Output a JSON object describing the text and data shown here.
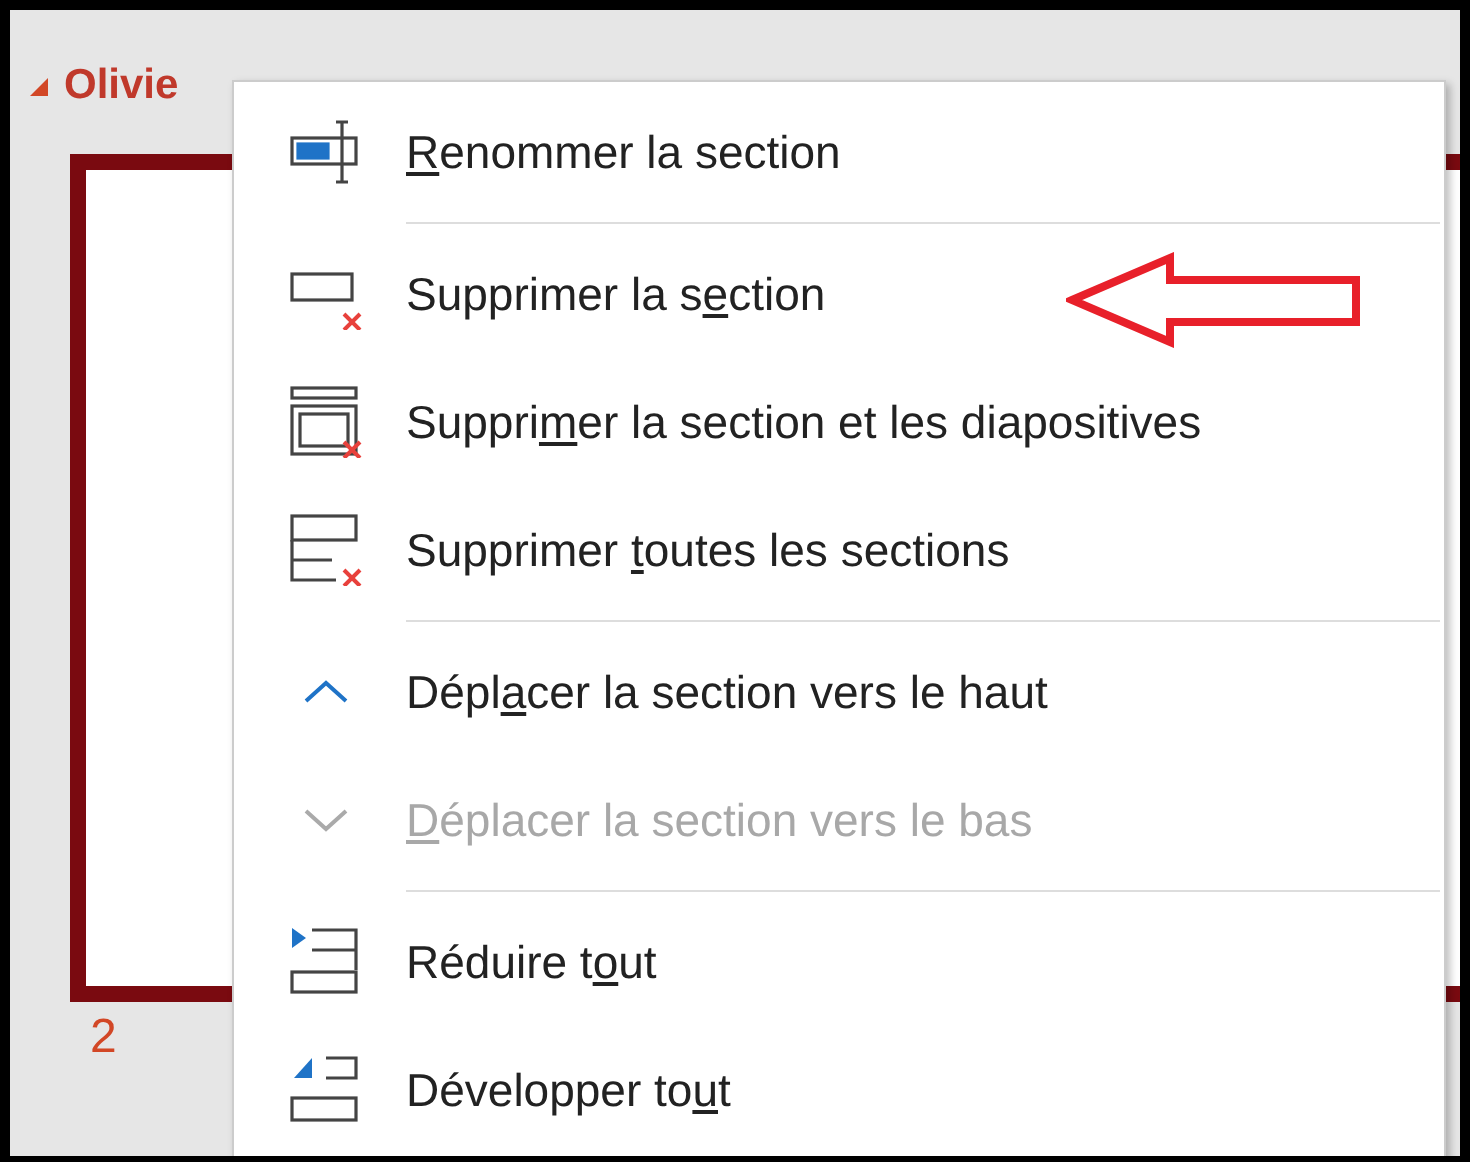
{
  "section_header": {
    "title": "Olivie",
    "expanded": true
  },
  "slide_number": "2",
  "context_menu": {
    "groups": [
      [
        {
          "disabled": false,
          "label": {
            "key": "R",
            "after": "enommer la section"
          }
        }
      ],
      [
        {
          "disabled": false,
          "label": {
            "before": "Supprimer la s",
            "key": "e",
            "after": "ction"
          }
        },
        {
          "disabled": false,
          "label": {
            "before": "Suppri",
            "key": "m",
            "after": "er la section et les diapositives"
          }
        },
        {
          "disabled": false,
          "label": {
            "before": "Supprimer ",
            "key": "t",
            "after": "outes les sections"
          }
        }
      ],
      [
        {
          "disabled": false,
          "label": {
            "before": "Dépl",
            "key": "a",
            "after": "cer la section vers le haut"
          }
        },
        {
          "disabled": true,
          "label": {
            "key": "D",
            "after": "éplacer la section vers le bas"
          }
        }
      ],
      [
        {
          "disabled": false,
          "label": {
            "before": "Réduire t",
            "key": "o",
            "after": "ut"
          }
        },
        {
          "disabled": false,
          "label": {
            "before": "Développer to",
            "key": "u",
            "after": "t"
          }
        }
      ]
    ]
  }
}
